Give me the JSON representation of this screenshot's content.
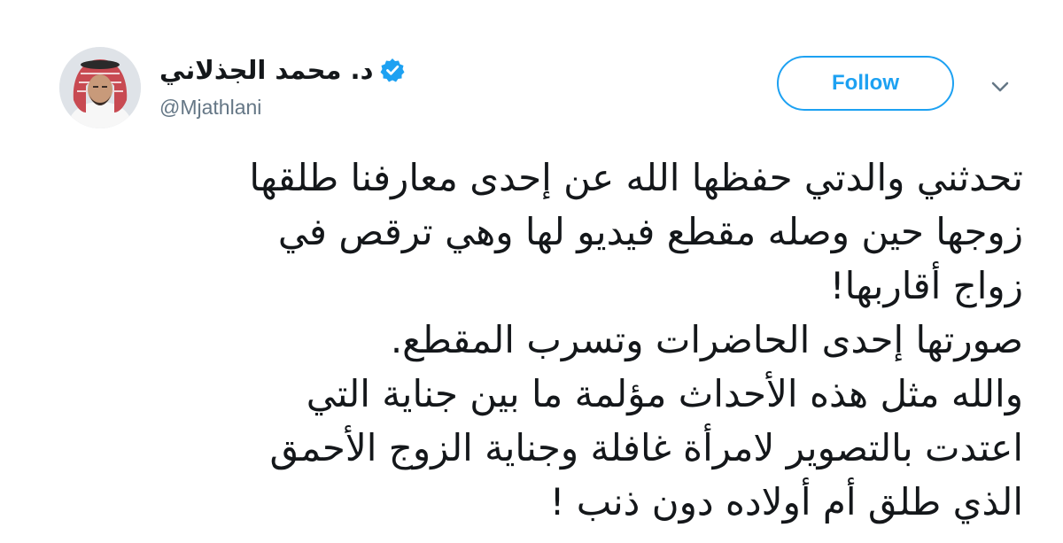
{
  "author": {
    "display_name": "د. محمد الجذلاني",
    "handle": "@Mjathlani",
    "verified": true,
    "avatar_icon": "profile-photo-avatar"
  },
  "actions": {
    "follow_label": "Follow",
    "more_icon": "chevron-down-icon"
  },
  "colors": {
    "accent": "#1da1f2",
    "text": "#14171a",
    "muted": "#657786"
  },
  "tweet": {
    "lines": [
      "تحدثني والدتي حفظها الله عن إحدى معارفنا طلقها",
      "زوجها حين وصله مقطع فيديو لها وهي ترقص في",
      "زواج أقاربها!",
      "صورتها إحدى الحاضرات وتسرب المقطع.",
      "والله مثل هذه الأحداث مؤلمة ما بين جناية التي",
      "اعتدت بالتصوير لامرأة غافلة وجناية الزوج الأحمق",
      "الذي طلق أم أولاده دون ذنب !"
    ]
  }
}
